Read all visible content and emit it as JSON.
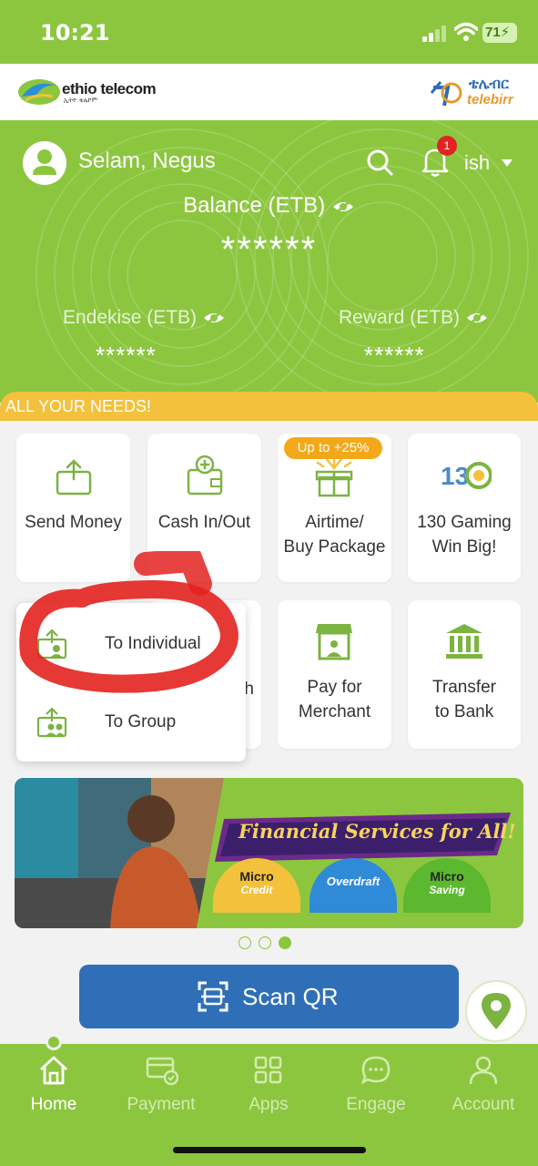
{
  "status_bar": {
    "time": "10:21",
    "battery": "71"
  },
  "brand": {
    "operator": "ethio telecom",
    "operator_sub": "ኢትዮ ቴሌኮም",
    "app_amharic": "ቴሌብር",
    "app_name": "telebirr"
  },
  "header": {
    "user_name": "Selam, Negus",
    "notification_count": "1",
    "language": "ish",
    "balance_label": "Balance (ETB)",
    "balance_value": "******",
    "endekise_label": "Endekise (ETB)",
    "endekise_value": "******",
    "reward_label": "Reward (ETB)",
    "reward_value": "******"
  },
  "section_title": "ALL YOUR NEEDS!",
  "services": {
    "send_money": "Send Money",
    "cash_in_out": "Cash In/Out",
    "airtime_line1": "Airtime/",
    "airtime_line2": "Buy Package",
    "airtime_badge": "Up to +25%",
    "gaming_line1": "130 Gaming",
    "gaming_line2": "Win Big!",
    "merchant_line1": "Pay for",
    "merchant_line2": "Merchant",
    "bank_line1": "Transfer",
    "bank_line2": "to Bank",
    "partial_label": "h"
  },
  "send_money_menu": {
    "to_individual": "To Individual",
    "to_group": "To Group"
  },
  "banner": {
    "title": "Financial Services for All!",
    "pills": [
      {
        "title": "Micro",
        "sub": "Credit",
        "color": "#f3c13b"
      },
      {
        "title": "",
        "sub": "Overdraft",
        "color": "#2f8ad8"
      },
      {
        "title": "Micro",
        "sub": "Saving",
        "color": "#5cb82e"
      }
    ],
    "carousel_index": 3,
    "carousel_count": 3
  },
  "scan_qr_label": "Scan QR",
  "bottom_nav": [
    {
      "label": "Home",
      "active": true
    },
    {
      "label": "Payment",
      "active": false
    },
    {
      "label": "Apps",
      "active": false
    },
    {
      "label": "Engage",
      "active": false
    },
    {
      "label": "Account",
      "active": false
    }
  ],
  "colors": {
    "primary_green": "#8cc63f",
    "accent_yellow": "#f3c13b",
    "scan_blue": "#2f6fb8",
    "annotation_red": "#e3221e"
  }
}
